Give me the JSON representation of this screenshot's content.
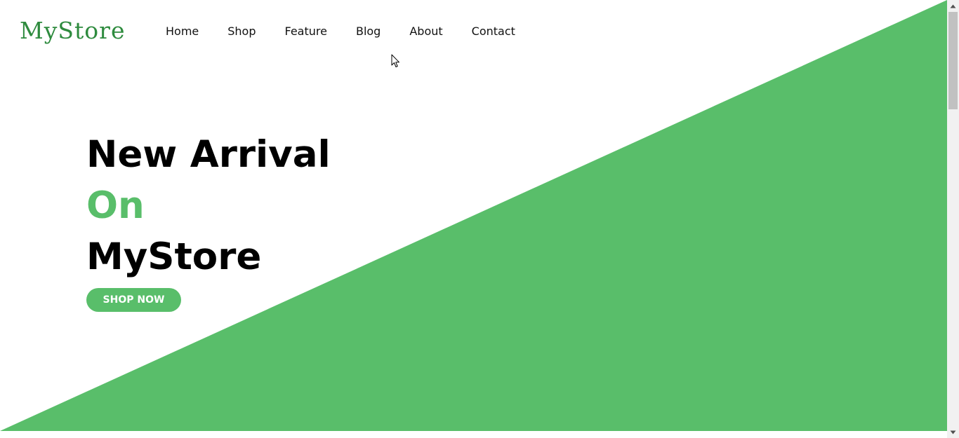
{
  "brand": {
    "logo_text": "MyStore",
    "accent_color": "#59be6a",
    "logo_color": "#2e8b3e"
  },
  "nav": {
    "items": [
      {
        "label": "Home"
      },
      {
        "label": "Shop"
      },
      {
        "label": "Feature"
      },
      {
        "label": "Blog"
      },
      {
        "label": "About"
      },
      {
        "label": "Contact"
      }
    ]
  },
  "hero": {
    "line1": "New Arrival",
    "line2": "On",
    "line3": "MyStore",
    "cta_label": "SHOP NOW"
  },
  "icons": {
    "cursor": "arrow-cursor-icon",
    "scroll_up": "chevron-up-icon",
    "scroll_down": "chevron-down-icon"
  }
}
